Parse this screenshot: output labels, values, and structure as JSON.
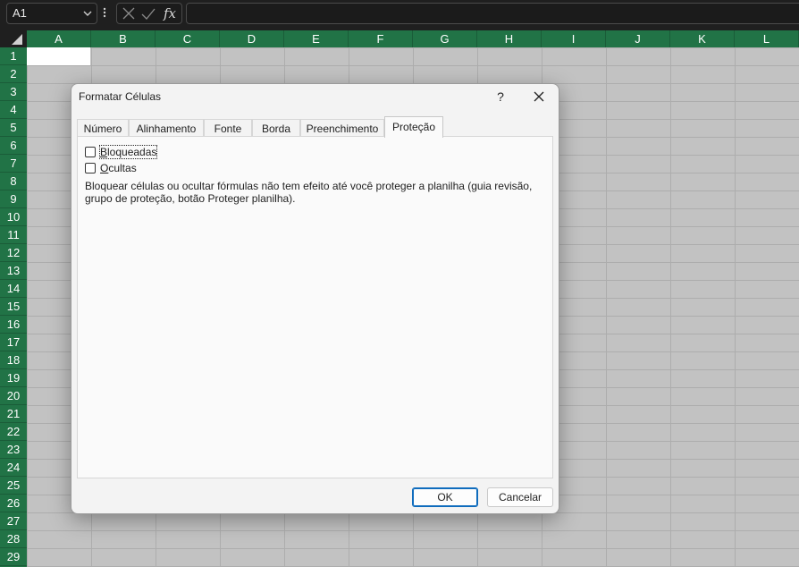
{
  "formula_bar": {
    "name_box": "A1",
    "name_box_chevron_icon": "chevron-down-icon",
    "more_icon": "more-vertical-icon",
    "cancel_icon": "x-icon",
    "enter_icon": "check-icon",
    "function_label": "fx",
    "formula": ""
  },
  "columns": [
    "A",
    "B",
    "C",
    "D",
    "E",
    "F",
    "G",
    "H",
    "I",
    "J",
    "K",
    "L"
  ],
  "rows": [
    "1",
    "2",
    "3",
    "4",
    "5",
    "6",
    "7",
    "8",
    "9",
    "10",
    "11",
    "12",
    "13",
    "14",
    "15",
    "16",
    "17",
    "18",
    "19",
    "20",
    "21",
    "22",
    "23",
    "24",
    "25",
    "26",
    "27",
    "28",
    "29"
  ],
  "colors": {
    "header_green": "#217346",
    "grid_gray": "#c2c2c2",
    "dark_bg": "#1f1f1f",
    "ok_border": "#0f6cbd"
  },
  "dialog": {
    "title": "Formatar Células",
    "help_label": "?",
    "close_icon": "close-icon",
    "tabs": [
      {
        "label": "Número",
        "active": false
      },
      {
        "label": "Alinhamento",
        "active": false
      },
      {
        "label": "Fonte",
        "active": false
      },
      {
        "label": "Borda",
        "active": false
      },
      {
        "label": "Preenchimento",
        "active": false
      },
      {
        "label": "Proteção",
        "active": true
      }
    ],
    "protection": {
      "locked_label": "Bloqueadas",
      "locked_checked": false,
      "hidden_label": "Ocultas",
      "hidden_checked": false,
      "note": "Bloquear células ou ocultar fórmulas não tem efeito até você proteger a planilha (guia revisão, grupo de proteção, botão Proteger planilha)."
    },
    "ok_label": "OK",
    "cancel_label": "Cancelar"
  }
}
